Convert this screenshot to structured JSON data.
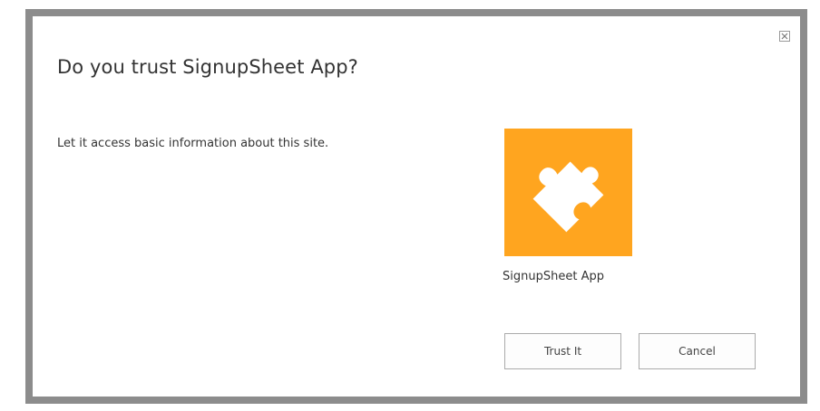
{
  "dialog": {
    "title": "Do you trust SignupSheet App?",
    "description": "Let it access basic information about this site.",
    "app": {
      "name": "SignupSheet App",
      "icon": "puzzle-piece-icon",
      "icon_background": "#ffa51f"
    },
    "buttons": {
      "trust_label": "Trust It",
      "cancel_label": "Cancel"
    },
    "close_icon": "close-icon"
  }
}
